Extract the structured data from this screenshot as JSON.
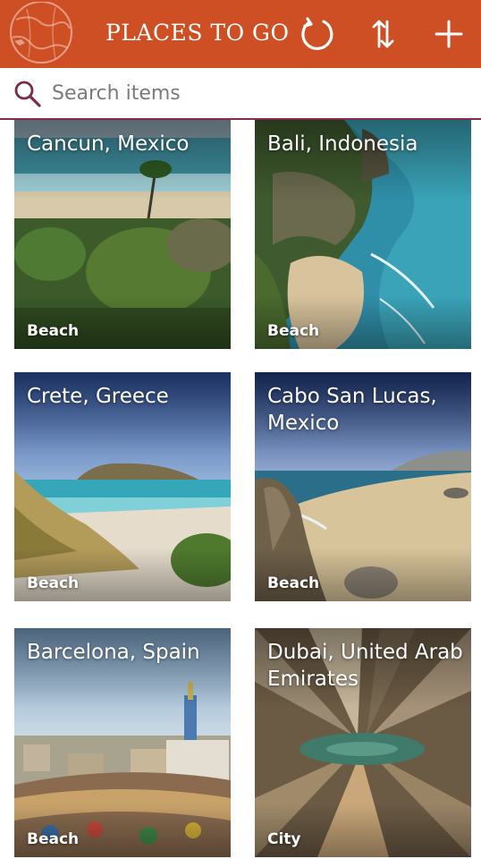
{
  "header": {
    "title": "PLACES TO GO",
    "refresh_icon": "refresh-icon",
    "sort_icon": "sort-icon",
    "add_icon": "add-icon",
    "accent_color": "#cf4f25"
  },
  "search": {
    "placeholder": "Search items",
    "value": ""
  },
  "places": [
    {
      "name": "Cancun, Mexico",
      "category": "Beach"
    },
    {
      "name": "Bali, Indonesia",
      "category": "Beach"
    },
    {
      "name": "Crete, Greece",
      "category": "Beach"
    },
    {
      "name": "Cabo San Lucas, Mexico",
      "category": "Beach"
    },
    {
      "name": "Barcelona, Spain",
      "category": "Beach"
    },
    {
      "name": "Dubai, United Arab Emirates",
      "category": "City"
    }
  ]
}
